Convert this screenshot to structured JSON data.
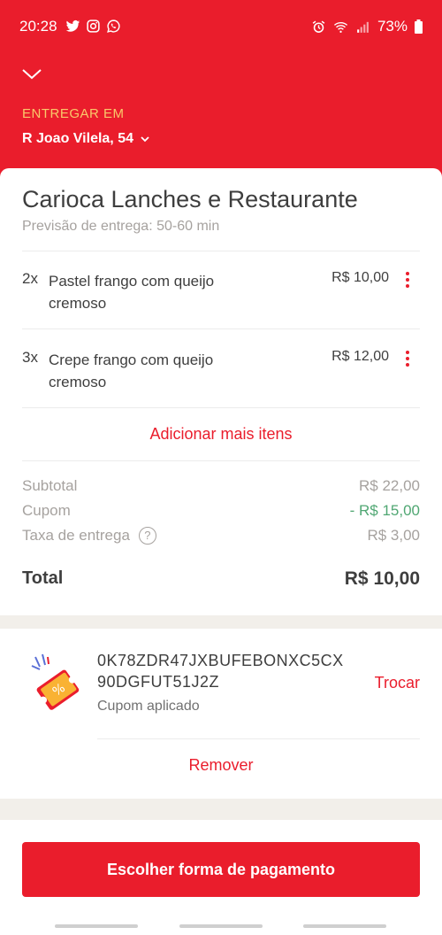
{
  "status_bar": {
    "time": "20:28",
    "battery": "73%",
    "left_icons": [
      "twitter-icon",
      "instagram-icon",
      "whatsapp-icon"
    ],
    "right_icons": [
      "alarm-icon",
      "wifi-icon",
      "signal-icon",
      "battery-icon"
    ]
  },
  "header": {
    "deliver_label": "ENTREGAR EM",
    "address": "R Joao Vilela, 54"
  },
  "order": {
    "restaurant": "Carioca Lanches e Restaurante",
    "eta": "Previsão de entrega: 50-60 min",
    "items": [
      {
        "qty": "2x",
        "name": "Pastel frango com queijo cremoso",
        "price": "R$  10,00"
      },
      {
        "qty": "3x",
        "name": "Crepe frango com queijo cremoso",
        "price": "R$  12,00"
      }
    ],
    "add_more": "Adicionar mais itens"
  },
  "summary": {
    "subtotal_label": "Subtotal",
    "subtotal_value": "R$  22,00",
    "coupon_label": "Cupom",
    "coupon_value": "- R$  15,00",
    "delivery_label": "Taxa de entrega",
    "delivery_value": "R$  3,00",
    "total_label": "Total",
    "total_value": "R$  10,00"
  },
  "coupon": {
    "code_line1": "0K78ZDR47JXBUFEBONXC5CX",
    "code_line2": "90DGFUT51J2Z",
    "status": "Cupom aplicado",
    "swap_label": "Trocar",
    "remove_label": "Remover"
  },
  "footer": {
    "pay_button": "Escolher forma de pagamento"
  },
  "colors": {
    "brand_red": "#ea1d2c",
    "accent_yellow": "#f9c86a",
    "discount_green": "#50a773"
  }
}
